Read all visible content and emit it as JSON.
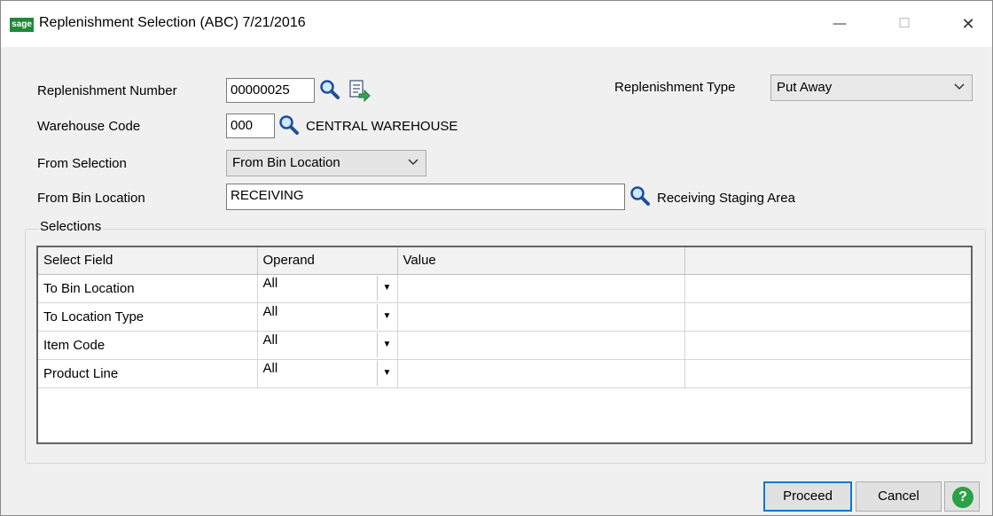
{
  "window": {
    "app_logo_text": "sage",
    "title": "Replenishment Selection (ABC) 7/21/2016",
    "controls": {
      "minimize": "—",
      "maximize": "☐",
      "close": "✕"
    }
  },
  "form": {
    "replenishment_number": {
      "label": "Replenishment Number",
      "value": "00000025"
    },
    "replenishment_type": {
      "label": "Replenishment Type",
      "value": "Put Away"
    },
    "warehouse_code": {
      "label": "Warehouse Code",
      "value": "000",
      "description": "CENTRAL WAREHOUSE"
    },
    "from_selection": {
      "label": "From Selection",
      "value": "From Bin Location"
    },
    "from_bin_location": {
      "label": "From Bin Location",
      "value": "RECEIVING",
      "description": "Receiving Staging Area"
    }
  },
  "selections": {
    "label": "Selections",
    "columns": [
      "Select Field",
      "Operand",
      "Value",
      ""
    ],
    "rows": [
      {
        "field": "To Bin Location",
        "operand": "All",
        "value": ""
      },
      {
        "field": "To Location Type",
        "operand": "All",
        "value": ""
      },
      {
        "field": "Item Code",
        "operand": "All",
        "value": ""
      },
      {
        "field": "Product Line",
        "operand": "All",
        "value": ""
      }
    ]
  },
  "buttons": {
    "proceed": "Proceed",
    "cancel": "Cancel",
    "help": "?"
  }
}
